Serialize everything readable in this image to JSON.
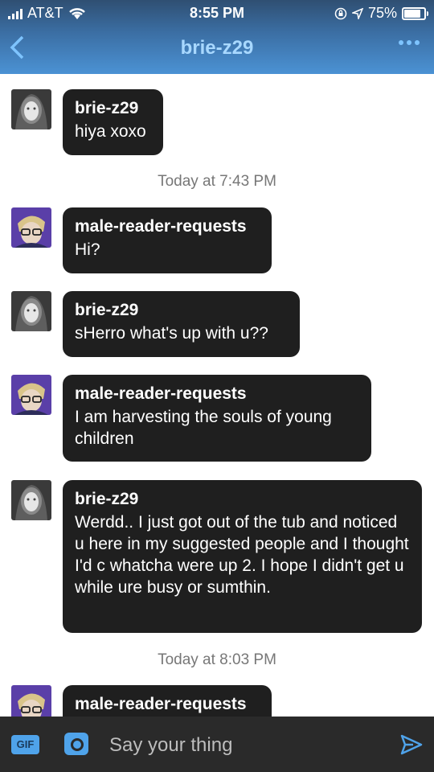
{
  "status_bar": {
    "carrier": "AT&T",
    "time": "8:55 PM",
    "battery": "75%"
  },
  "header": {
    "title": "brie-z29"
  },
  "messages": [
    {
      "sender": "brie-z29",
      "text": "hiya xoxo"
    },
    {
      "sender": "male-reader-requests",
      "text": "Hi?"
    },
    {
      "sender": "brie-z29",
      "text": "sHerro what's up with u??"
    },
    {
      "sender": "male-reader-requests",
      "text": "I am harvesting the souls of young children"
    },
    {
      "sender": "brie-z29",
      "text": "Werdd.. I just got out of the tub and noticed u here in my suggested people and I thought I'd c whatcha were up 2. I hope I didn't get u while ure busy or sumthin."
    },
    {
      "sender": "male-reader-requests",
      "text": ""
    }
  ],
  "timestamps": [
    "Today at 7:43 PM",
    "Today at 8:03 PM"
  ],
  "composer": {
    "gif_label": "GIF",
    "placeholder": "Say your thing"
  },
  "colors": {
    "header_accent": "#7ec4ff",
    "bubble": "#1f1f1f",
    "composer_bg": "#2a2a2a",
    "button_blue": "#4fa3ea"
  }
}
